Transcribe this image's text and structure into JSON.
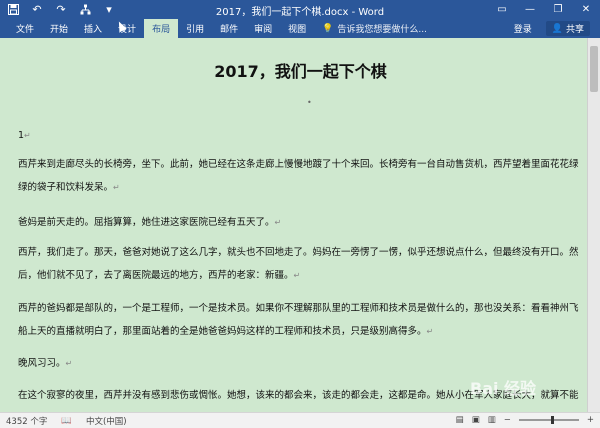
{
  "window": {
    "title": "2017，我们一起下个棋.docx - Word"
  },
  "ribbon": {
    "tabs": [
      "文件",
      "开始",
      "插入",
      "设计",
      "布局",
      "引用",
      "邮件",
      "审阅",
      "视图"
    ],
    "active_tab": "布局",
    "tell_me": "告诉我您想要做什么...",
    "login": "登录",
    "share": "共享"
  },
  "document": {
    "title": "2017，我们一起下个棋",
    "center_mark": "•",
    "paragraphs": [
      "1",
      "西芹来到走廊尽头的长椅旁，坐下。此前，她已经在这条走廊上慢慢地踱了十个来回。长椅旁有一台自动售货机，西芹望着里面花花绿绿的袋子和饮料发呆。",
      "爸妈是前天走的。屈指算算，她住进这家医院已经有五天了。",
      "西芹，我们走了。那天，爸爸对她说了这么几字，就头也不回地走了。妈妈在一旁愣了一愣，似乎还想说点什么，但最终没有开口。然后，他们就不见了，去了离医院最远的地方，西芹的老家：新疆。",
      "西芹的爸妈都是部队的，一个是工程师，一个是技术员。如果你不理解那队里的工程师和技术员是做什么的，那也没关系：看看神州飞船上天的直播就明白了，那里面站着的全是她爸爸妈妈这样的工程师和技术员，只是级别高得多。",
      "晚风习习。",
      "在这个寂寥的夜里，西芹并没有感到悲伤或惆怅。她想，该来的都会来，该走的都会走，这都是命。她从小在军人家庭长大，就算不能看透他也必"
    ],
    "para_mark": "↵"
  },
  "status": {
    "word_count": "4352 个字",
    "language": "中文(中国)",
    "watermark": "Bai 经验"
  },
  "icons": {
    "save": "save-icon",
    "undo": "undo-icon",
    "redo": "redo-icon",
    "tree": "structure-icon"
  }
}
